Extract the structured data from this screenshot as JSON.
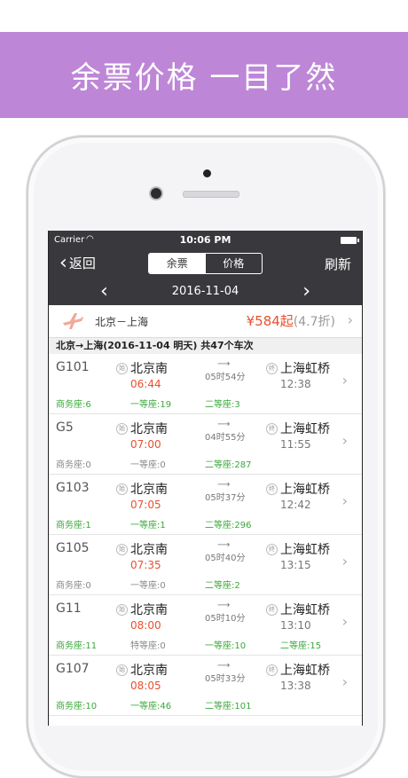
{
  "banner": {
    "title": "余票价格  一目了然"
  },
  "status": {
    "carrier": "Carrier",
    "time": "10:06 PM"
  },
  "nav": {
    "back_label": "返回",
    "seg_tickets": "余票",
    "seg_price": "价格",
    "refresh_label": "刷新"
  },
  "datebar": {
    "date": "2016-11-04",
    "prev": "‹",
    "next": "›"
  },
  "route": {
    "name": "北京－上海",
    "price": "¥584起",
    "discount": "(4.7折)"
  },
  "summary": "北京→上海(2016-11-04 明天) 共47个车次",
  "colors": {
    "banner": "#bd86d6",
    "header": "#39393d",
    "red": "#e8502f",
    "green": "#3aa83a"
  },
  "trains": [
    {
      "no": "G101",
      "from": "北京南",
      "dep": "06:44",
      "dur": "05时54分",
      "to": "上海虹桥",
      "arr": "12:38",
      "s1": "商务座:6",
      "s1c": "g",
      "s2": "一等座:19",
      "s2c": "g",
      "s3": "二等座:3",
      "s3c": "g"
    },
    {
      "no": "G5",
      "from": "北京南",
      "dep": "07:00",
      "dur": "04时55分",
      "to": "上海虹桥",
      "arr": "11:55",
      "s1": "商务座:0",
      "s1c": "gy",
      "s2": "一等座:0",
      "s2c": "gy",
      "s3": "二等座:287",
      "s3c": "g"
    },
    {
      "no": "G103",
      "from": "北京南",
      "dep": "07:05",
      "dur": "05时37分",
      "to": "上海虹桥",
      "arr": "12:42",
      "s1": "商务座:1",
      "s1c": "g",
      "s2": "一等座:1",
      "s2c": "g",
      "s3": "二等座:296",
      "s3c": "g"
    },
    {
      "no": "G105",
      "from": "北京南",
      "dep": "07:35",
      "dur": "05时40分",
      "to": "上海虹桥",
      "arr": "13:15",
      "s1": "商务座:0",
      "s1c": "gy",
      "s2": "一等座:0",
      "s2c": "gy",
      "s3": "二等座:2",
      "s3c": "g"
    },
    {
      "no": "G11",
      "from": "北京南",
      "dep": "08:00",
      "dur": "05时10分",
      "to": "上海虹桥",
      "arr": "13:10",
      "s1": "商务座:11",
      "s1c": "g",
      "s2": "特等座:0",
      "s2c": "gy",
      "s3": "一等座:10",
      "s3c": "g",
      "s4": "二等座:15",
      "s4c": "g"
    },
    {
      "no": "G107",
      "from": "北京南",
      "dep": "08:05",
      "dur": "05时33分",
      "to": "上海虹桥",
      "arr": "13:38",
      "s1": "商务座:10",
      "s1c": "g",
      "s2": "一等座:46",
      "s2c": "g",
      "s3": "二等座:101",
      "s3c": "g"
    }
  ]
}
